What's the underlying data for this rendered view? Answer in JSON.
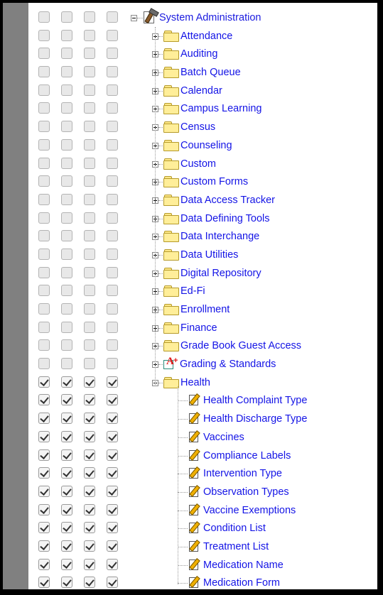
{
  "tree": {
    "root": {
      "label": "System Administration",
      "icon": "tools-admin-icon"
    },
    "items": [
      {
        "label": "Attendance",
        "icon": "folder-icon",
        "expanded": false,
        "checked": [
          false,
          false,
          false,
          false
        ]
      },
      {
        "label": "Auditing",
        "icon": "folder-icon",
        "expanded": false,
        "checked": [
          false,
          false,
          false,
          false
        ]
      },
      {
        "label": "Batch Queue",
        "icon": "folder-icon",
        "expanded": false,
        "checked": [
          false,
          false,
          false,
          false
        ]
      },
      {
        "label": "Calendar",
        "icon": "folder-icon",
        "expanded": false,
        "checked": [
          false,
          false,
          false,
          false
        ]
      },
      {
        "label": "Campus Learning",
        "icon": "folder-icon",
        "expanded": false,
        "checked": [
          false,
          false,
          false,
          false
        ]
      },
      {
        "label": "Census",
        "icon": "folder-icon",
        "expanded": false,
        "checked": [
          false,
          false,
          false,
          false
        ]
      },
      {
        "label": "Counseling",
        "icon": "folder-icon",
        "expanded": false,
        "checked": [
          false,
          false,
          false,
          false
        ]
      },
      {
        "label": "Custom",
        "icon": "folder-icon",
        "expanded": false,
        "checked": [
          false,
          false,
          false,
          false
        ]
      },
      {
        "label": "Custom Forms",
        "icon": "folder-icon",
        "expanded": false,
        "checked": [
          false,
          false,
          false,
          false
        ]
      },
      {
        "label": "Data Access Tracker",
        "icon": "folder-icon",
        "expanded": false,
        "checked": [
          false,
          false,
          false,
          false
        ]
      },
      {
        "label": "Data Defining Tools",
        "icon": "folder-icon",
        "expanded": false,
        "checked": [
          false,
          false,
          false,
          false
        ]
      },
      {
        "label": "Data Interchange",
        "icon": "folder-icon",
        "expanded": false,
        "checked": [
          false,
          false,
          false,
          false
        ]
      },
      {
        "label": "Data Utilities",
        "icon": "folder-icon",
        "expanded": false,
        "checked": [
          false,
          false,
          false,
          false
        ]
      },
      {
        "label": "Digital Repository",
        "icon": "folder-icon",
        "expanded": false,
        "checked": [
          false,
          false,
          false,
          false
        ]
      },
      {
        "label": "Ed-Fi",
        "icon": "folder-icon",
        "expanded": false,
        "checked": [
          false,
          false,
          false,
          false
        ]
      },
      {
        "label": "Enrollment",
        "icon": "folder-icon",
        "expanded": false,
        "checked": [
          false,
          false,
          false,
          false
        ]
      },
      {
        "label": "Finance",
        "icon": "folder-icon",
        "expanded": false,
        "checked": [
          false,
          false,
          false,
          false
        ]
      },
      {
        "label": "Grade Book Guest Access",
        "icon": "folder-icon",
        "expanded": false,
        "checked": [
          false,
          false,
          false,
          false
        ]
      },
      {
        "label": "Grading & Standards",
        "icon": "grading-icon",
        "expanded": false,
        "checked": [
          false,
          false,
          false,
          false
        ]
      },
      {
        "label": "Health",
        "icon": "folder-icon",
        "expanded": true,
        "checked": [
          true,
          true,
          true,
          true
        ]
      }
    ],
    "health_children": [
      {
        "label": "Health Complaint Type",
        "icon": "edit-page-icon",
        "checked": [
          true,
          true,
          true,
          true
        ]
      },
      {
        "label": "Health Discharge Type",
        "icon": "edit-page-icon",
        "checked": [
          true,
          true,
          true,
          true
        ]
      },
      {
        "label": "Vaccines",
        "icon": "edit-page-icon",
        "checked": [
          true,
          true,
          true,
          true
        ]
      },
      {
        "label": "Compliance Labels",
        "icon": "edit-page-icon",
        "checked": [
          true,
          true,
          true,
          true
        ]
      },
      {
        "label": "Intervention Type",
        "icon": "edit-page-icon",
        "checked": [
          true,
          true,
          true,
          true
        ]
      },
      {
        "label": "Observation Types",
        "icon": "edit-page-icon",
        "checked": [
          true,
          true,
          true,
          true
        ]
      },
      {
        "label": "Vaccine Exemptions",
        "icon": "edit-page-icon",
        "checked": [
          true,
          true,
          true,
          true
        ]
      },
      {
        "label": "Condition List",
        "icon": "edit-page-icon",
        "checked": [
          true,
          true,
          true,
          true
        ]
      },
      {
        "label": "Treatment List",
        "icon": "edit-page-icon",
        "checked": [
          true,
          true,
          true,
          true
        ]
      },
      {
        "label": "Medication Name",
        "icon": "edit-page-icon",
        "checked": [
          true,
          true,
          true,
          true
        ]
      },
      {
        "label": "Medication Form",
        "icon": "edit-page-icon",
        "checked": [
          true,
          true,
          true,
          true
        ]
      }
    ]
  }
}
